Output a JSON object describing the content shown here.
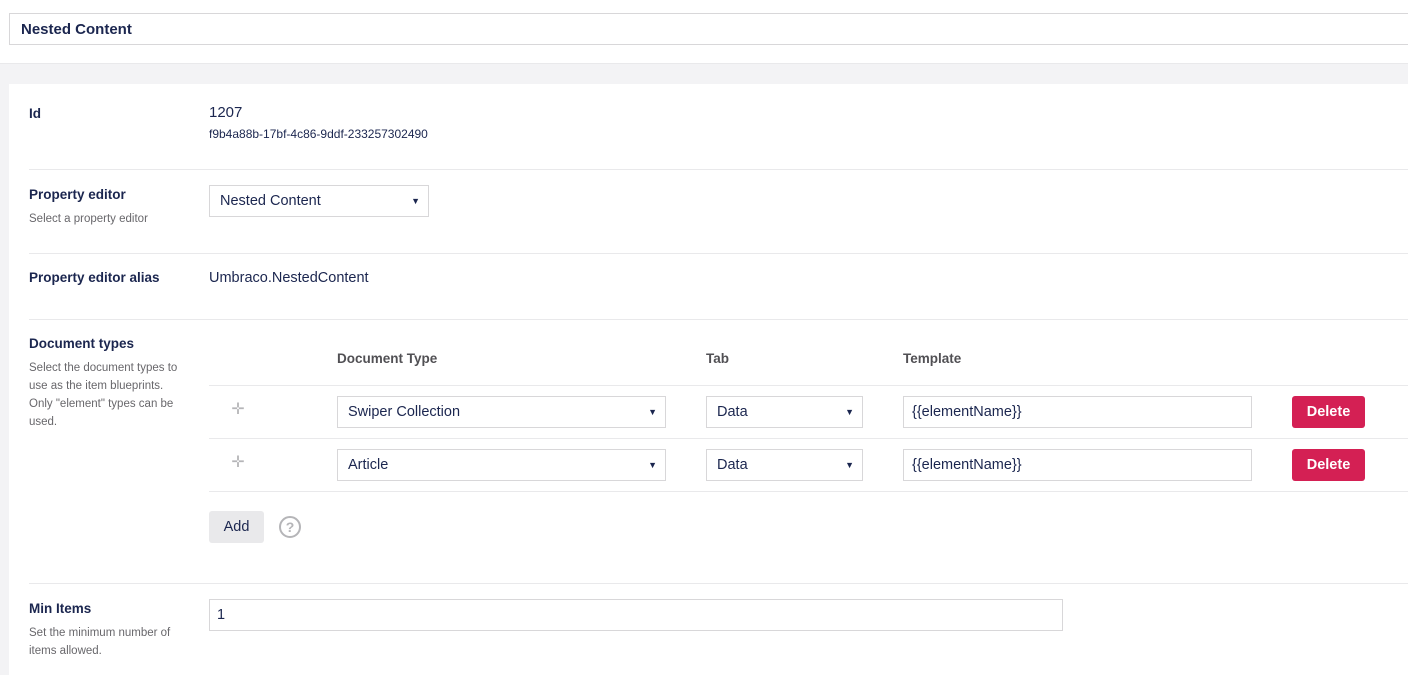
{
  "header": {
    "name_value": "Nested Content"
  },
  "id_section": {
    "label": "Id",
    "id_number": "1207",
    "guid": "f9b4a88b-17bf-4c86-9ddf-233257302490"
  },
  "property_editor": {
    "label": "Property editor",
    "description": "Select a property editor",
    "selected": "Nested Content"
  },
  "property_editor_alias": {
    "label": "Property editor alias",
    "value": "Umbraco.NestedContent"
  },
  "document_types": {
    "label": "Document types",
    "description": "Select the document types to use as the item blueprints. Only \"element\" types can be used.",
    "columns": {
      "document_type": "Document Type",
      "tab": "Tab",
      "template": "Template"
    },
    "rows": [
      {
        "document_type": "Swiper Collection",
        "tab": "Data",
        "template": "{{elementName}}",
        "delete_label": "Delete"
      },
      {
        "document_type": "Article",
        "tab": "Data",
        "template": "{{elementName}}",
        "delete_label": "Delete"
      }
    ],
    "add_label": "Add",
    "help_glyph": "?"
  },
  "min_items": {
    "label": "Min Items",
    "description": "Set the minimum number of items allowed.",
    "value": "1"
  },
  "icons": {
    "drag": "drag-handle-icon",
    "caret": "caret-down-icon",
    "help": "help-circle-icon"
  },
  "colors": {
    "danger": "#d42054",
    "text": "#1b264f",
    "muted": "#68676b",
    "border": "#d8d7d9"
  }
}
